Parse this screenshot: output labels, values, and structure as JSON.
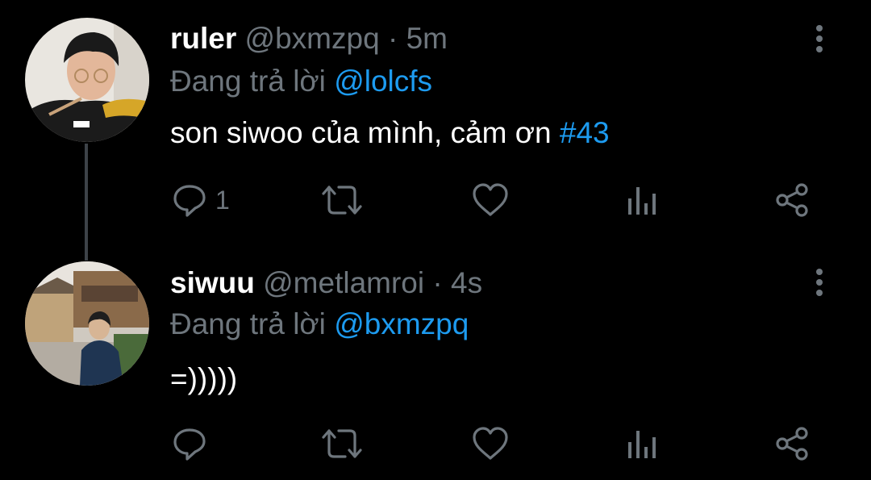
{
  "tweets": [
    {
      "name": "ruler",
      "handle": "@bxmzpq",
      "separator": "·",
      "time": "5m",
      "reply_prefix": "Đang trả lời",
      "reply_to": "@lolcfs",
      "text": "son siwoo của mình, cảm ơn",
      "hashtag": "#43",
      "reply_count": "1",
      "avatar": "avatar-photo"
    },
    {
      "name": "siwuu",
      "handle": "@metlamroi",
      "separator": "·",
      "time": "4s",
      "reply_prefix": "Đang trả lời",
      "reply_to": "@bxmzpq",
      "text": "=)))))",
      "reply_count": "",
      "avatar": "avatar-photo"
    }
  ],
  "colors": {
    "background": "#000000",
    "muted": "#6e767d",
    "accent": "#1d9bf0",
    "thread_line": "#3d4248"
  },
  "icons": [
    "reply-icon",
    "retweet-icon",
    "like-icon",
    "analytics-icon",
    "share-icon",
    "more-icon"
  ]
}
